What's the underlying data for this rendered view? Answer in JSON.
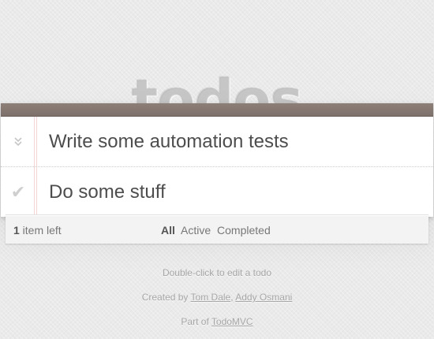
{
  "header": {
    "title": "todos"
  },
  "todos": [
    {
      "label": "Write some automation tests",
      "toggle_icon": "double-chevron-down-icon"
    },
    {
      "label": "Do some stuff",
      "toggle_icon": "checkmark-icon"
    }
  ],
  "footer": {
    "count": "1",
    "count_suffix": " item left",
    "filters": [
      "All",
      "Active",
      "Completed"
    ],
    "selected_filter": "All"
  },
  "info": {
    "hint": "Double-click to edit a todo",
    "created_by_prefix": "Created by ",
    "author1": "Tom Dale",
    "separator": ", ",
    "author2": "Addy Osmani",
    "part_of_prefix": "Part of ",
    "part_of_link": "TodoMVC"
  },
  "colors": {
    "background": "#eaeaea",
    "header_bar": "#8d7f78",
    "title_text": "#aaaaaa",
    "todo_text": "#4d4d4d",
    "margin_line": "#f5d6d6"
  }
}
